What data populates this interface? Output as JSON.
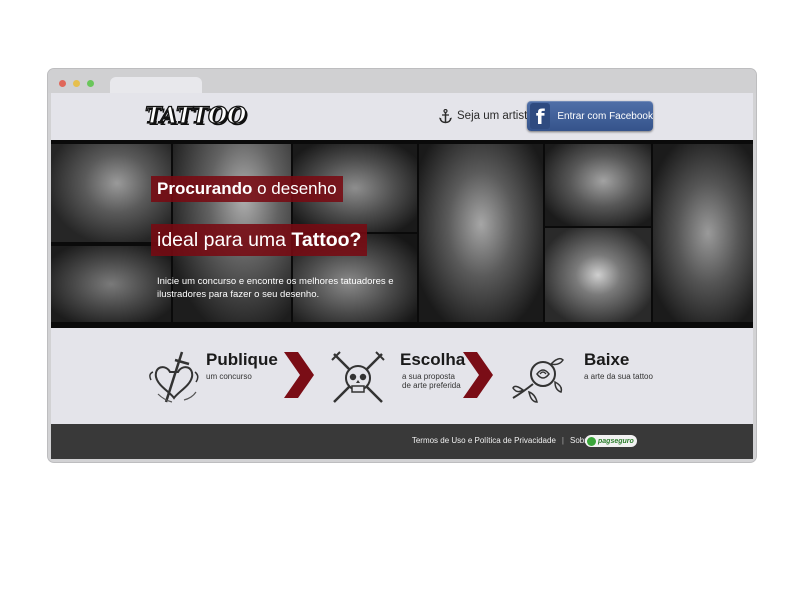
{
  "header": {
    "logo_text": "TATTOO",
    "artist_link": "Seja um artista",
    "facebook_button": "Entrar com Facebook",
    "facebook_icon_letter": "f"
  },
  "hero": {
    "headline_1_strong": "Procurando",
    "headline_1_rest": " o desenho",
    "headline_2_rest": "ideal para uma ",
    "headline_2_strong": "Tattoo?",
    "description": "Inicie um concurso e encontre os melhores tatuadores e ilustradores para fazer o seu desenho."
  },
  "steps": [
    {
      "title": "Publique",
      "subtitle": "um concurso",
      "icon": "heart-dagger-icon"
    },
    {
      "title": "Escolha",
      "subtitle_1": "a sua proposta",
      "subtitle_2": "de arte preferida",
      "icon": "skull-crossed-daggers-icon"
    },
    {
      "title": "Baixe",
      "subtitle": "a arte da sua tattoo",
      "icon": "rose-icon"
    }
  ],
  "footer": {
    "terms": "Termos de Uso e Política de Privacidade",
    "about": "Sobre o 747700",
    "payment_badge": "pagseguro"
  },
  "colors": {
    "accent_red": "#7a0d16",
    "facebook_blue": "#3b5998",
    "footer_bg": "#393939"
  }
}
